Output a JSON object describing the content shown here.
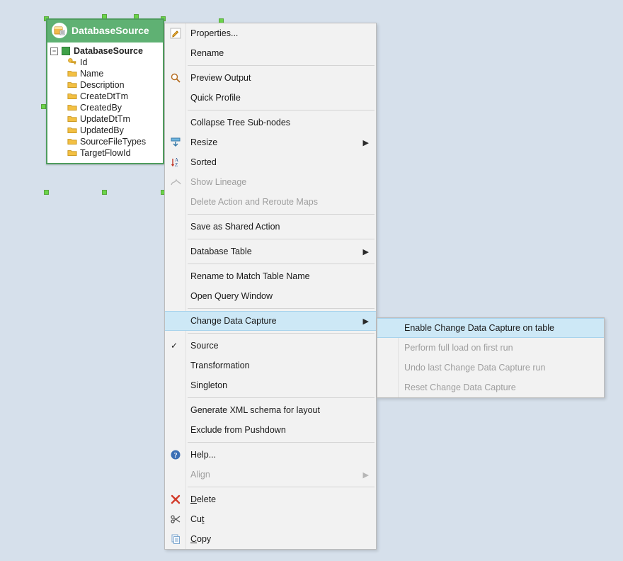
{
  "node": {
    "title": "DatabaseSource",
    "root_label": "DatabaseSource",
    "fields": [
      {
        "name": "Id",
        "icon": "key"
      },
      {
        "name": "Name",
        "icon": "folder"
      },
      {
        "name": "Description",
        "icon": "folder"
      },
      {
        "name": "CreateDtTm",
        "icon": "folder"
      },
      {
        "name": "CreatedBy",
        "icon": "folder"
      },
      {
        "name": "UpdateDtTm",
        "icon": "folder"
      },
      {
        "name": "UpdatedBy",
        "icon": "folder"
      },
      {
        "name": "SourceFileTypes",
        "icon": "folder"
      },
      {
        "name": "TargetFlowId",
        "icon": "folder"
      }
    ]
  },
  "context_menu": {
    "items": [
      {
        "label": "Properties...",
        "icon": "pencil"
      },
      {
        "label": "Rename"
      },
      {
        "sep": true
      },
      {
        "label": "Preview Output",
        "icon": "magnifier"
      },
      {
        "label": "Quick Profile"
      },
      {
        "sep": true
      },
      {
        "label": "Collapse Tree Sub-nodes"
      },
      {
        "label": "Resize",
        "icon": "resize",
        "submenu": true
      },
      {
        "label": "Sorted",
        "icon": "sort"
      },
      {
        "label": "Show Lineage",
        "icon": "lineage",
        "disabled": true
      },
      {
        "label": "Delete Action and Reroute Maps",
        "disabled": true
      },
      {
        "sep": true
      },
      {
        "label": "Save as Shared Action"
      },
      {
        "sep": true
      },
      {
        "label": "Database Table",
        "submenu": true
      },
      {
        "sep": true
      },
      {
        "label": "Rename to Match Table Name"
      },
      {
        "label": "Open Query Window"
      },
      {
        "sep": true
      },
      {
        "label": "Change Data Capture",
        "submenu": true,
        "highlighted": true
      },
      {
        "sep": true
      },
      {
        "label": "Source",
        "checked": true
      },
      {
        "label": "Transformation"
      },
      {
        "label": "Singleton"
      },
      {
        "sep": true
      },
      {
        "label": "Generate XML schema for layout"
      },
      {
        "label": "Exclude from Pushdown"
      },
      {
        "sep": true
      },
      {
        "label": "Help...",
        "icon": "help"
      },
      {
        "label": "Align",
        "submenu": true,
        "disabled": true
      },
      {
        "sep": true
      },
      {
        "label": "Delete",
        "icon": "delete-x",
        "mnemonic": "D"
      },
      {
        "label": "Cut",
        "icon": "scissors",
        "mnemonic": "t"
      },
      {
        "label": "Copy",
        "icon": "copy",
        "mnemonic": "C"
      }
    ]
  },
  "submenu_cdc": {
    "items": [
      {
        "label": "Enable Change Data Capture on table",
        "highlighted": true
      },
      {
        "label": "Perform full load on first run",
        "disabled": true
      },
      {
        "label": "Undo last Change Data Capture run",
        "disabled": true
      },
      {
        "label": "Reset Change Data Capture",
        "disabled": true
      }
    ]
  }
}
